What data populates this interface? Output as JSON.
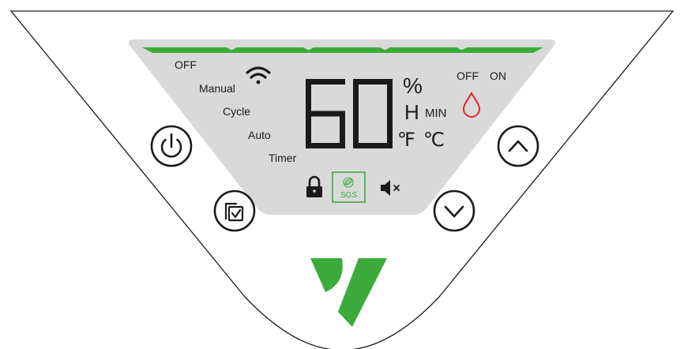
{
  "display": {
    "value": "60",
    "level_bar_segments_lit": 5,
    "level_bar_segments_total": 5,
    "units": {
      "percent": "%",
      "hours": "H",
      "minutes": "MIN",
      "fahrenheit": "℉",
      "celsius": "℃"
    },
    "modes": [
      "OFF",
      "Manual",
      "Cycle",
      "Auto",
      "Timer"
    ],
    "pump": {
      "off_label": "OFF",
      "on_label": "ON"
    },
    "badge": "SGS"
  },
  "icons": {
    "wifi": "wifi-icon",
    "water_drop": "water-drop-icon",
    "lock": "lock-icon",
    "mute": "mute-icon",
    "leaf": "leaf-icon",
    "power": "power-icon",
    "mode": "mode-select-icon",
    "up": "chevron-up-icon",
    "down": "chevron-down-icon",
    "logo": "brand-logo-icon"
  },
  "colors": {
    "accent_green": "#3cab3b",
    "display_bg": "#d9d9d9",
    "drop_red": "#e5232e",
    "text": "#1a1a1a"
  }
}
